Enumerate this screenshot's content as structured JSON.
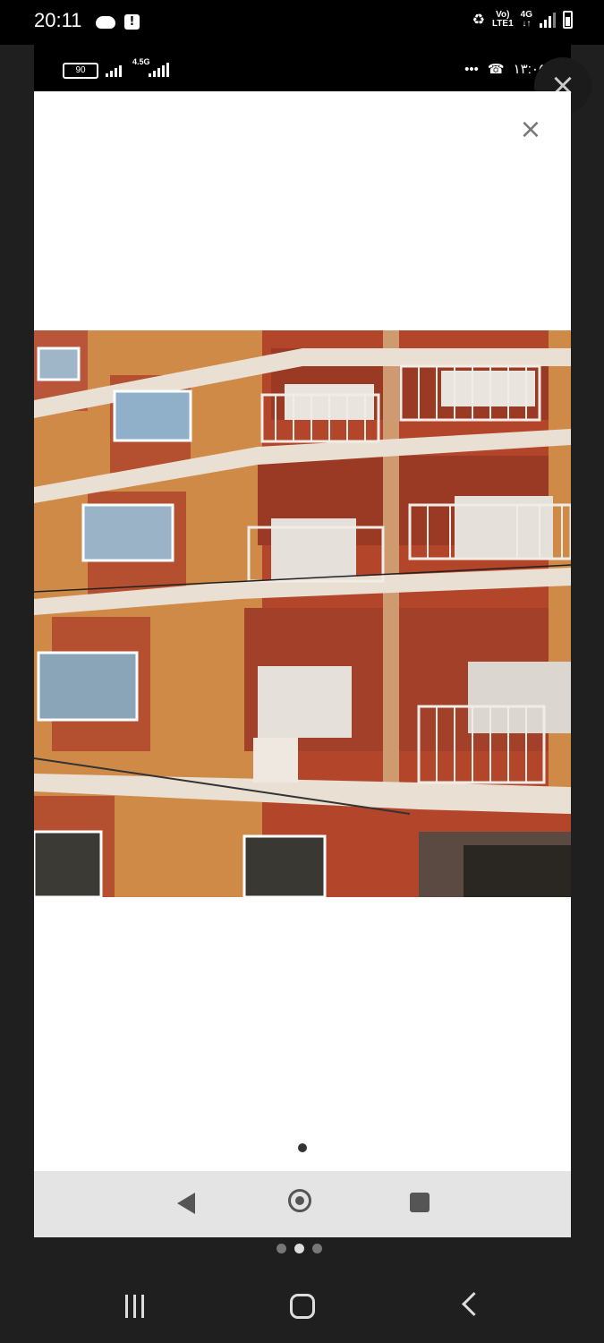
{
  "status_bar": {
    "time": "20:11",
    "alert_glyph": "!",
    "volte_top": "Vo)",
    "volte_bottom": "LTE1",
    "network_top": "4G",
    "network_bottom": "↓↑"
  },
  "inner_status_bar": {
    "battery": "90",
    "network": "4.5G",
    "dots": "•••",
    "time": "۱۳:۰۵"
  },
  "viewer": {
    "close_glyph": "×",
    "overlay_close_glyph": "×",
    "image_alt": "Orange and red apartment building facade with white-railed balconies",
    "page_count": 1,
    "current_page": 1
  },
  "screenshot_pager": {
    "count": 3,
    "active_index": 1
  },
  "colors": {
    "wall_orange": "#d08a48",
    "wall_red": "#b4482e",
    "trim_white": "#e8e2da",
    "status_black": "#000000",
    "nav_gray": "#e4e4e4"
  }
}
